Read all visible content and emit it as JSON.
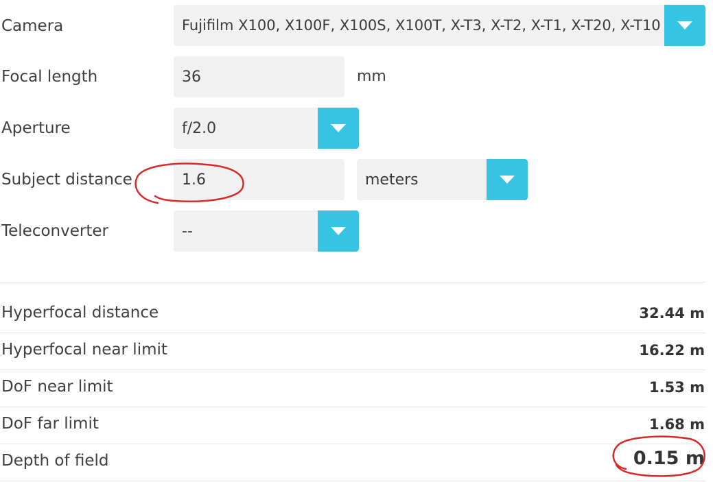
{
  "form": {
    "camera": {
      "label": "Camera",
      "value": "Fujifilm X100, X100F, X100S, X100T, X-T3, X-T2, X-T1, X-T20, X-T10",
      "control_icon": "chevron-down-icon"
    },
    "focal_length": {
      "label": "Focal length",
      "value": "36",
      "unit": "mm"
    },
    "aperture": {
      "label": "Aperture",
      "value": "f/2.0",
      "control_icon": "chevron-down-icon"
    },
    "subject_distance": {
      "label": "Subject distance",
      "value": "1.6",
      "unit_value": "meters",
      "control_icon": "chevron-down-icon"
    },
    "teleconverter": {
      "label": "Teleconverter",
      "value": "--",
      "control_icon": "chevron-down-icon"
    }
  },
  "results": [
    {
      "label": "Hyperfocal distance",
      "value": "32.44 m"
    },
    {
      "label": "Hyperfocal near limit",
      "value": "16.22 m"
    },
    {
      "label": "DoF near limit",
      "value": "1.53 m"
    },
    {
      "label": "DoF far limit",
      "value": "1.68 m"
    },
    {
      "label": "Depth of field",
      "value": "0.15 m"
    }
  ],
  "colors": {
    "accent": "#36c3e4",
    "field_bg": "#f1f1f1",
    "annotation": "#d42a2a"
  }
}
